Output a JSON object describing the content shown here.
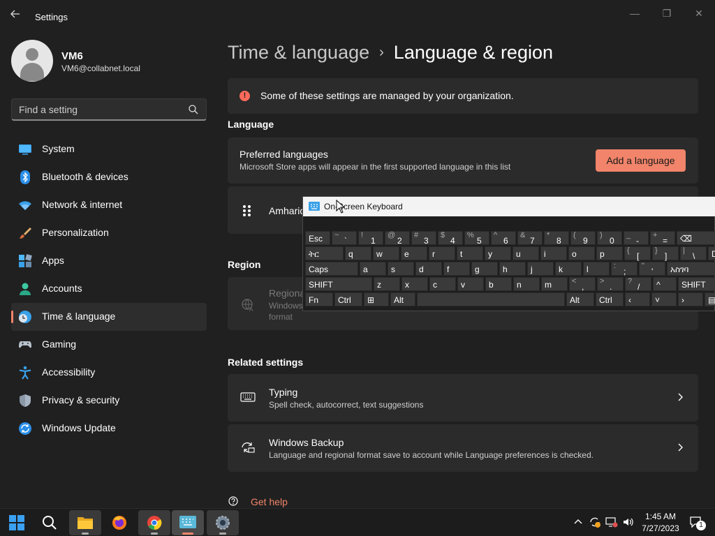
{
  "window": {
    "title": "Settings",
    "controls": {
      "minimize": "—",
      "maximize": "❐",
      "close": "✕"
    }
  },
  "user": {
    "name": "VM6",
    "email": "VM6@collabnet.local"
  },
  "search": {
    "placeholder": "Find a setting"
  },
  "sidebar": {
    "items": [
      {
        "label": "System",
        "icon": "system-icon"
      },
      {
        "label": "Bluetooth & devices",
        "icon": "bluetooth-icon"
      },
      {
        "label": "Network & internet",
        "icon": "wifi-icon"
      },
      {
        "label": "Personalization",
        "icon": "brush-icon"
      },
      {
        "label": "Apps",
        "icon": "apps-icon"
      },
      {
        "label": "Accounts",
        "icon": "accounts-icon"
      },
      {
        "label": "Time & language",
        "icon": "time-language-icon",
        "selected": true
      },
      {
        "label": "Gaming",
        "icon": "gamepad-icon"
      },
      {
        "label": "Accessibility",
        "icon": "accessibility-icon"
      },
      {
        "label": "Privacy & security",
        "icon": "shield-icon"
      },
      {
        "label": "Windows Update",
        "icon": "update-icon"
      }
    ]
  },
  "breadcrumb": {
    "parent": "Time & language",
    "separator": "›",
    "current": "Language & region"
  },
  "notice": {
    "icon": "!",
    "text": "Some of these settings are managed by your organization."
  },
  "language": {
    "section_title": "Language",
    "preferred": {
      "title": "Preferred languages",
      "subtitle": "Microsoft Store apps will appear in the first supported language in this list",
      "add_button": "Add a language"
    },
    "entry": "Amharic"
  },
  "region": {
    "section_title": "Region",
    "title": "Regiona",
    "line1": "Windows",
    "line2": "format"
  },
  "related": {
    "section_title": "Related settings",
    "items": [
      {
        "title": "Typing",
        "subtitle": "Spell check, autocorrect, text suggestions",
        "icon": "keyboard-icon"
      },
      {
        "title": "Windows Backup",
        "subtitle": "Language and regional format save to account while Language preferences is checked.",
        "icon": "backup-icon"
      }
    ]
  },
  "help": {
    "label": "Get help"
  },
  "osk": {
    "title": "On-Screen Keyboard",
    "rows": [
      [
        {
          "main": "Esc",
          "w": 36
        },
        {
          "up": "~",
          "low": "`",
          "w": 36
        },
        {
          "up": "!",
          "low": "1",
          "w": 36
        },
        {
          "up": "@",
          "low": "2",
          "w": 36
        },
        {
          "up": "#",
          "low": "3",
          "w": 36
        },
        {
          "up": "$",
          "low": "4",
          "w": 36
        },
        {
          "up": "%",
          "low": "5",
          "w": 36
        },
        {
          "up": "^",
          "low": "6",
          "w": 36
        },
        {
          "up": "&",
          "low": "7",
          "w": 36
        },
        {
          "up": "*",
          "low": "8",
          "w": 36
        },
        {
          "up": "(",
          "low": "9",
          "w": 36
        },
        {
          "up": ")",
          "low": "0",
          "w": 36
        },
        {
          "up": "_",
          "low": "-",
          "w": 36
        },
        {
          "up": "+",
          "low": "=",
          "w": 36
        },
        {
          "main": "⌫",
          "w": 72
        }
      ],
      [
        {
          "main": "ትር",
          "w": 55
        },
        {
          "main": "q",
          "w": 38
        },
        {
          "main": "w",
          "w": 38
        },
        {
          "main": "e",
          "w": 38
        },
        {
          "main": "r",
          "w": 38
        },
        {
          "main": "t",
          "w": 38
        },
        {
          "main": "y",
          "w": 38
        },
        {
          "main": "u",
          "w": 38
        },
        {
          "main": "i",
          "w": 38
        },
        {
          "main": "o",
          "w": 38
        },
        {
          "main": "p",
          "w": 38
        },
        {
          "up": "{",
          "low": "[",
          "w": 38
        },
        {
          "up": "}",
          "low": "]",
          "w": 38
        },
        {
          "up": "|",
          "low": "\\",
          "w": 38
        },
        {
          "main": "Del",
          "w": 40
        }
      ],
      [
        {
          "main": "Caps",
          "w": 76
        },
        {
          "main": "a",
          "w": 38
        },
        {
          "main": "s",
          "w": 38
        },
        {
          "main": "d",
          "w": 38
        },
        {
          "main": "f",
          "w": 38
        },
        {
          "main": "g",
          "w": 38
        },
        {
          "main": "h",
          "w": 38
        },
        {
          "main": "j",
          "w": 38
        },
        {
          "main": "k",
          "w": 38
        },
        {
          "main": "l",
          "w": 38
        },
        {
          "up": ":",
          "low": ";",
          "w": 38
        },
        {
          "up": "\"",
          "low": "'",
          "w": 38
        },
        {
          "main": "አስገባ",
          "w": 95
        }
      ],
      [
        {
          "main": "SHIFT",
          "w": 96
        },
        {
          "main": "z",
          "w": 38
        },
        {
          "main": "x",
          "w": 38
        },
        {
          "main": "c",
          "w": 38
        },
        {
          "main": "v",
          "w": 38
        },
        {
          "main": "b",
          "w": 38
        },
        {
          "main": "n",
          "w": 38
        },
        {
          "main": "m",
          "w": 38
        },
        {
          "up": "<",
          "low": ",",
          "w": 38
        },
        {
          "up": ">",
          "low": ".",
          "w": 38
        },
        {
          "up": "?",
          "low": "/",
          "w": 38
        },
        {
          "main": "^",
          "w": 34
        },
        {
          "main": "SHIFT",
          "w": 76
        }
      ],
      [
        {
          "main": "Fn",
          "w": 40
        },
        {
          "main": "Ctrl",
          "w": 40
        },
        {
          "main": "⊞",
          "w": 36,
          "icon": "windows-key-icon"
        },
        {
          "main": "Alt",
          "w": 36
        },
        {
          "main": "",
          "w": 212
        },
        {
          "main": "Alt",
          "w": 40
        },
        {
          "main": "Ctrl",
          "w": 40
        },
        {
          "main": "‹",
          "w": 36
        },
        {
          "main": "˅",
          "w": 36
        },
        {
          "main": "›",
          "w": 36
        },
        {
          "main": "▤",
          "w": 40,
          "icon": "osk-options-icon"
        }
      ]
    ]
  },
  "taskbar": {
    "apps": [
      "windows-start-icon",
      "search-icon",
      "file-explorer-icon",
      "firefox-icon",
      "chrome-icon",
      "on-screen-keyboard-icon",
      "settings-app-icon"
    ],
    "time": "1:45 AM",
    "date": "7/27/2023",
    "notification_count": "1"
  },
  "colors": {
    "accent": "#f1846a",
    "background": "#202020",
    "card": "#2b2b2b"
  }
}
